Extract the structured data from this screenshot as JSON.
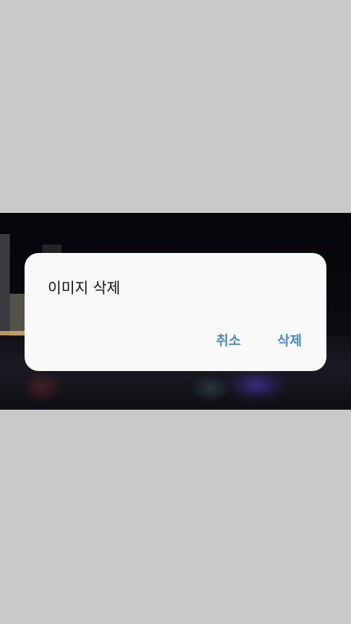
{
  "dialog": {
    "title": "이미지 삭제",
    "cancel_label": "취소",
    "delete_label": "삭제"
  },
  "colors": {
    "accent": "#4a8bc4",
    "dialog_background": "#f9f9f9",
    "screen_background": "#c9c9c9"
  }
}
